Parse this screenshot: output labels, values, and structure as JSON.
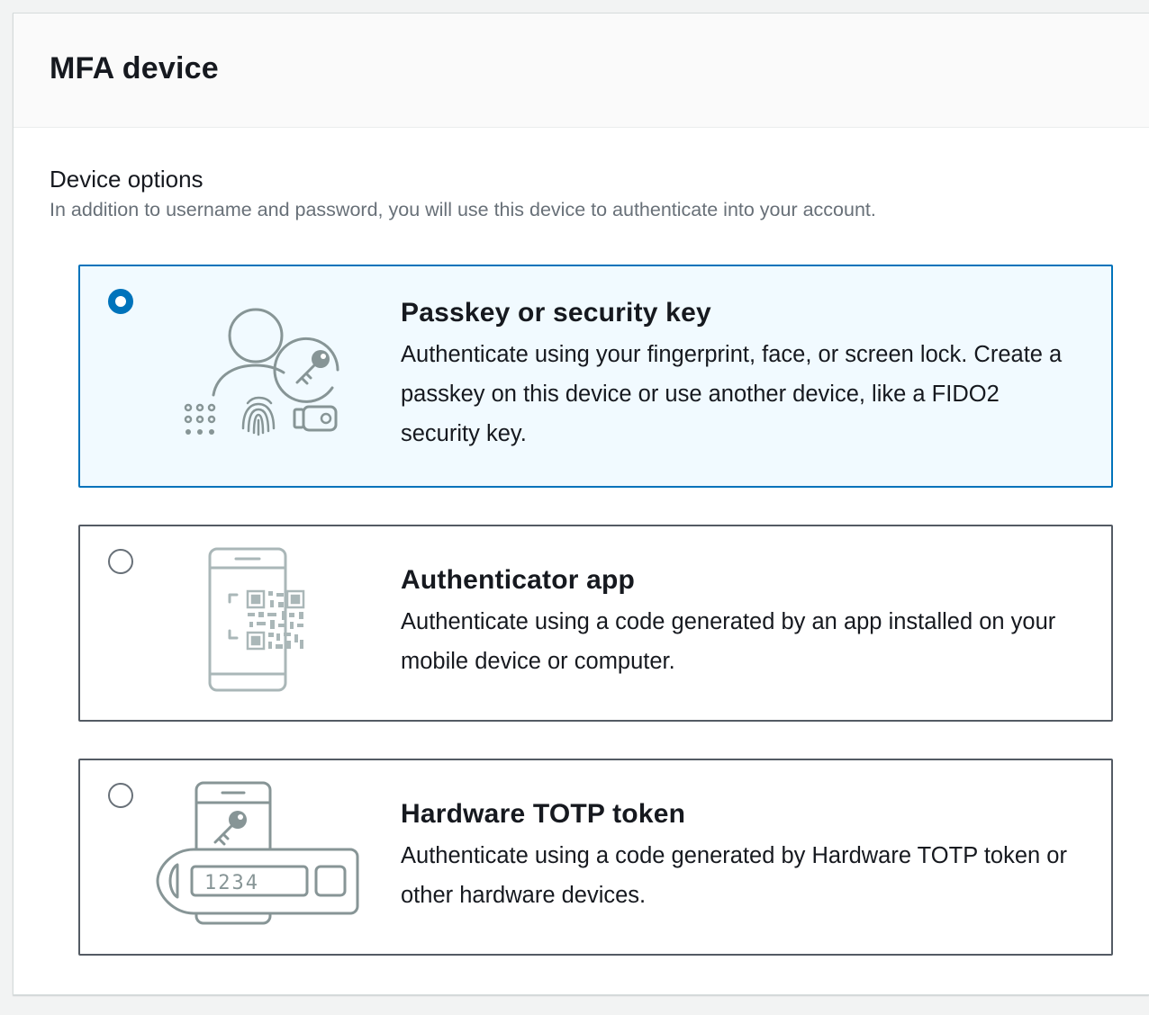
{
  "panel": {
    "title": "MFA device"
  },
  "device_options": {
    "label": "Device options",
    "description": "In addition to username and password, you will use this device to authenticate into your account.",
    "options": [
      {
        "title": "Passkey or security key",
        "description": "Authenticate using your fingerprint, face, or screen lock. Create a passkey on this device or use another device, like a FIDO2 security key.",
        "selected": true,
        "illustration": "passkey-illustration"
      },
      {
        "title": "Authenticator app",
        "description": "Authenticate using a code generated by an app installed on your mobile device or computer.",
        "selected": false,
        "illustration": "authenticator-app-illustration"
      },
      {
        "title": "Hardware TOTP token",
        "description": "Authenticate using a code generated by Hardware TOTP token or other hardware devices.",
        "selected": false,
        "illustration": "hardware-token-illustration",
        "token_display": "1234"
      }
    ]
  },
  "colors": {
    "selected_border": "#0073bb",
    "selected_background": "#f1faff",
    "border": "#545b64",
    "description_text": "#687078"
  }
}
